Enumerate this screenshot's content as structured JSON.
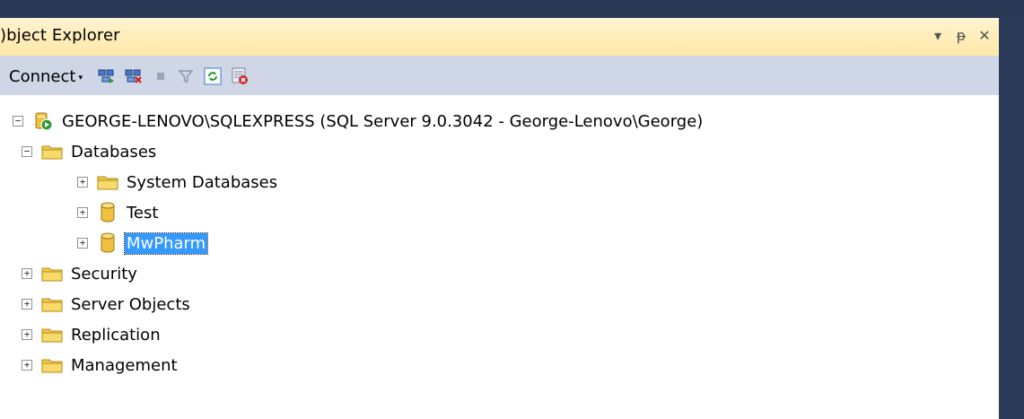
{
  "panel": {
    "title": ")bject Explorer",
    "controls": [
      "▾",
      "ᵽ",
      "✕"
    ]
  },
  "toolbar": {
    "connect_label": "Connect",
    "connect_caret": "▾",
    "buttons": [
      "connect-object-explorer-icon",
      "disconnect-icon",
      "stop-icon",
      "filter-icon",
      "refresh-icon",
      "activity-monitor-icon"
    ]
  },
  "tree": {
    "server": "GEORGE-LENOVO\\SQLEXPRESS (SQL Server 9.0.3042 - George-Lenovo\\George)",
    "databases": "Databases",
    "system_databases": "System Databases",
    "db1": "Test",
    "db2": "MwPharm",
    "security": "Security",
    "server_objects": "Server Objects",
    "replication": "Replication",
    "management": "Management",
    "expanded_glyph": "−",
    "collapsed_glyph": "+"
  },
  "colors": {
    "title_bg": "#ffe8a6",
    "toolbar_bg": "#cfd6e5",
    "selection": "#3399ff",
    "folder": "#f2c94c"
  }
}
